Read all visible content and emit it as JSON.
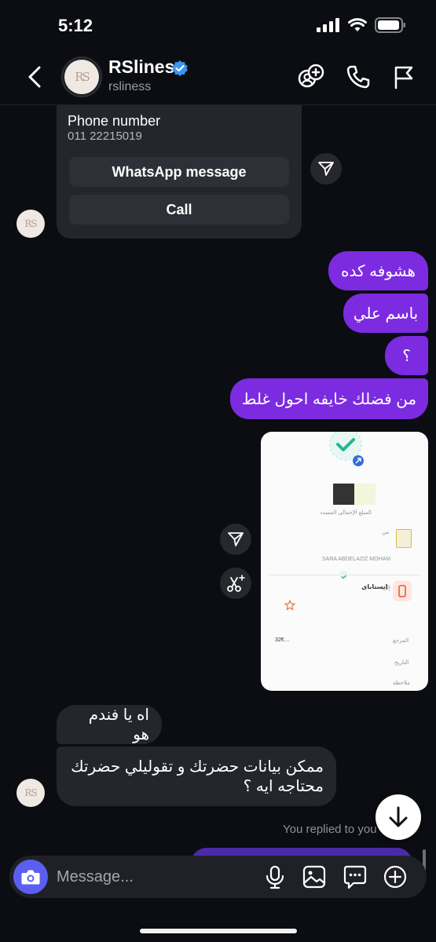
{
  "status": {
    "time": "5:12"
  },
  "header": {
    "name": "RSlines",
    "handle": "rsliness",
    "avatar_text": "RS"
  },
  "contact_card": {
    "title": "Phone number",
    "phone": "011 22215019",
    "whatsapp_label": "WhatsApp message",
    "call_label": "Call"
  },
  "messages": {
    "out_1": "هشوفه كده",
    "out_2": "باسم علي",
    "out_3": "؟",
    "out_4": "من فضلك خايفه احول غلط",
    "in_1": "اه يا فندم هو",
    "in_2_line1": "ممكن بيانات حضرتك و تقوليلي حضرتك",
    "in_2_line2": "محتاجه ايه ؟"
  },
  "receipt": {
    "sender_label": "المبلغ الإجمالي المسدد",
    "from_label": "من",
    "from_name": "SARA ABDELAZIZ MOHAM",
    "to_label": "إلى",
    "to_name": "انستاباي",
    "ref_label": "المرجع",
    "ref_value": "32€…",
    "date_label": "التاريخ",
    "note_label": "ملاحظة"
  },
  "replied_text": "You replied to you",
  "composer": {
    "placeholder": "Message..."
  },
  "colors": {
    "accent": "#7c2be0",
    "camera": "#5b5ff0",
    "verified": "#3897f0",
    "incoming": "#24262c",
    "background": "#0b0d12"
  }
}
